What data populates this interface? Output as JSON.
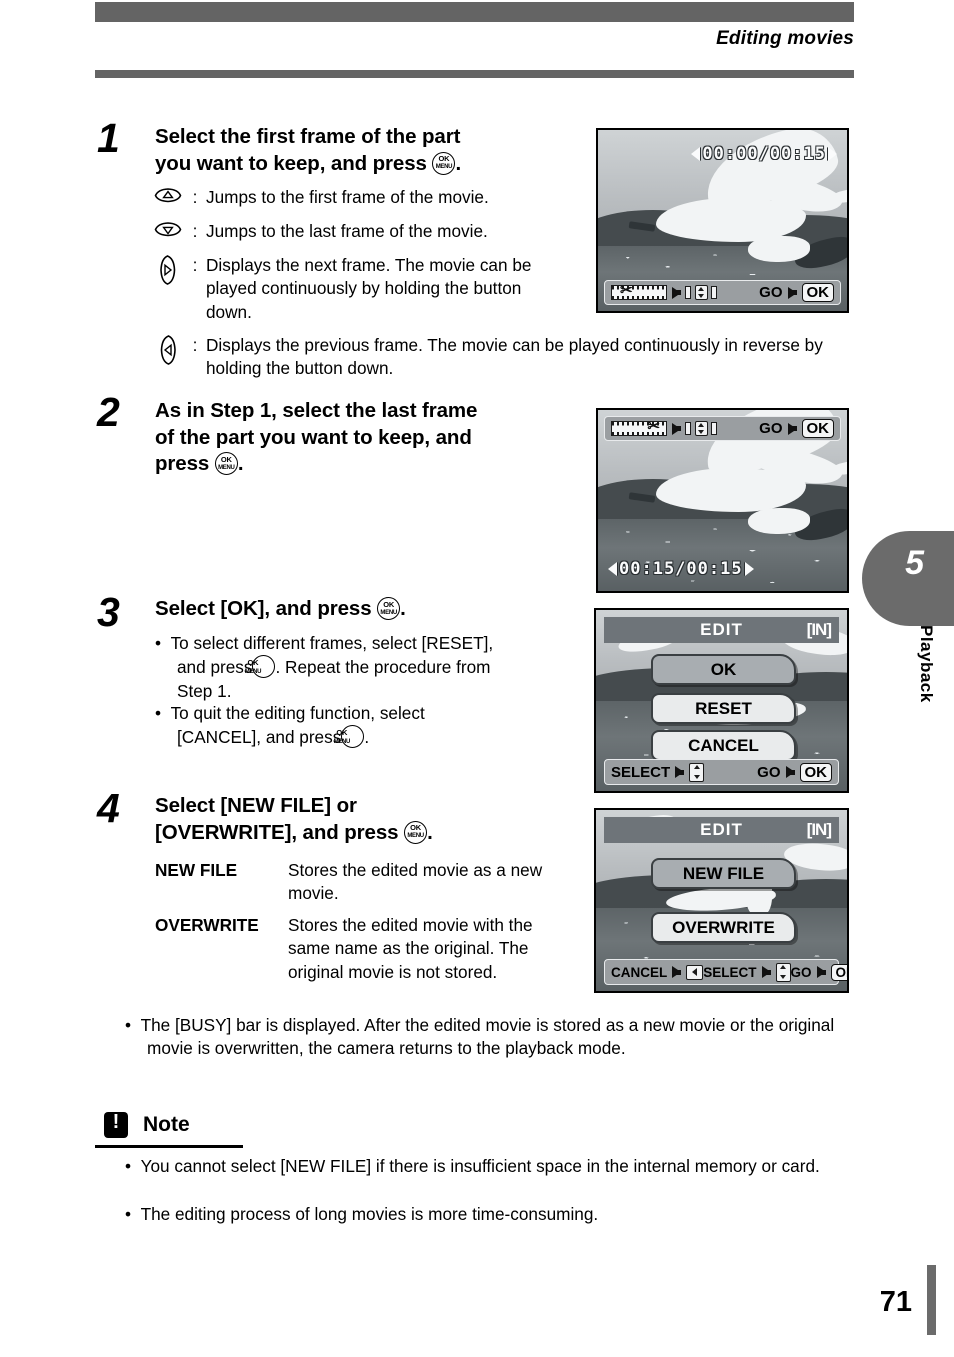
{
  "header": {
    "title": "Editing movies"
  },
  "side_tab": {
    "number": "5",
    "label": "Playback"
  },
  "footer": {
    "page_number": "71"
  },
  "steps": [
    {
      "number": "1",
      "heading_part1": "Select the first frame of the part",
      "heading_part2": "you want to keep, and press",
      "heading_suffix": ".",
      "icon_rows": [
        {
          "icon": "dpad-up-icon",
          "colon": ":",
          "text": "Jumps to the first frame of the movie."
        },
        {
          "icon": "dpad-down-icon",
          "colon": ":",
          "text": "Jumps to the last frame of the movie."
        },
        {
          "icon": "dpad-right-icon",
          "colon": ":",
          "text": "Displays the next frame. The movie can be played continuously by holding the button down."
        },
        {
          "icon": "dpad-left-icon",
          "colon": ":",
          "text": "Displays the previous frame. The movie can be played continuously in reverse by holding the button down."
        }
      ]
    },
    {
      "number": "2",
      "heading_part1": "As in Step 1, select the last frame",
      "heading_part2": "of the part you want to keep, and",
      "heading_part3": "press",
      "heading_suffix": "."
    },
    {
      "number": "3",
      "heading_part1": "Select [OK], and press",
      "heading_suffix": ".",
      "bullets": [
        "To select different frames, select [RESET], and press",
        ". Repeat the procedure from Step 1.",
        "To quit the editing function, select [CANCEL], and press",
        "."
      ],
      "bullet1_a": "To select different frames, select",
      "bullet1_b": "[RESET], and press",
      "bullet1_c": ". Repeat the",
      "bullet1_d": "procedure from Step 1.",
      "bullet2_a": "To quit the editing function, select",
      "bullet2_b": "[CANCEL], and press",
      "bullet2_c": "."
    },
    {
      "number": "4",
      "heading_part1": "Select [NEW FILE] or",
      "heading_part2": "[OVERWRITE], and press",
      "heading_suffix": ".",
      "definitions": [
        {
          "term": "NEW FILE",
          "desc": "Stores the edited movie as a new movie."
        },
        {
          "term": "OVERWRITE",
          "desc": "Stores the edited movie with the same name as the original. The original movie is not stored."
        }
      ],
      "closing_bullet": "The [BUSY] bar is displayed. After the edited movie is stored as a new movie or the original movie is overwritten, the camera returns to the playback mode."
    }
  ],
  "note": {
    "title": "Note",
    "icon": "exclamation-icon",
    "items": [
      "You cannot select [NEW FILE] if there is insufficient space in the internal memory or card.",
      "The editing process of long movies is more time-consuming."
    ]
  },
  "screens": {
    "screen1": {
      "name": "movie-start-frame-screen",
      "timecode": "00:00/00:15",
      "bar": {
        "film_icon": "film-scissors-icon",
        "pad_icon": "four-way-pad-icon",
        "go_label": "GO",
        "ok_label": "OK"
      }
    },
    "screen2": {
      "name": "movie-end-frame-screen",
      "timecode": "00:15/00:15",
      "bar": {
        "film_icon": "film-scissors-icon",
        "pad_icon": "four-way-pad-icon",
        "go_label": "GO",
        "ok_label": "OK"
      }
    },
    "screen3": {
      "name": "edit-confirm-menu",
      "title": "EDIT",
      "location": "[IN]",
      "items": [
        {
          "label": "OK",
          "selected": true
        },
        {
          "label": "RESET",
          "selected": false
        },
        {
          "label": "CANCEL",
          "selected": false
        }
      ],
      "foot": {
        "select_label": "SELECT",
        "go_label": "GO",
        "ok_label": "OK"
      }
    },
    "screen4": {
      "name": "edit-save-menu",
      "title": "EDIT",
      "location": "[IN]",
      "items": [
        {
          "label": "NEW FILE",
          "selected": true
        },
        {
          "label": "OVERWRITE",
          "selected": false
        }
      ],
      "foot": {
        "cancel_label": "CANCEL",
        "select_label": "SELECT",
        "go_label": "GO",
        "ok_label": "OK"
      }
    }
  },
  "okmenu_button": {
    "top": "OK",
    "bottom": "MENU"
  },
  "colors": {
    "rule": "#646464",
    "tab": "#6b6b6b",
    "menu_selected": "#a8adb1"
  }
}
